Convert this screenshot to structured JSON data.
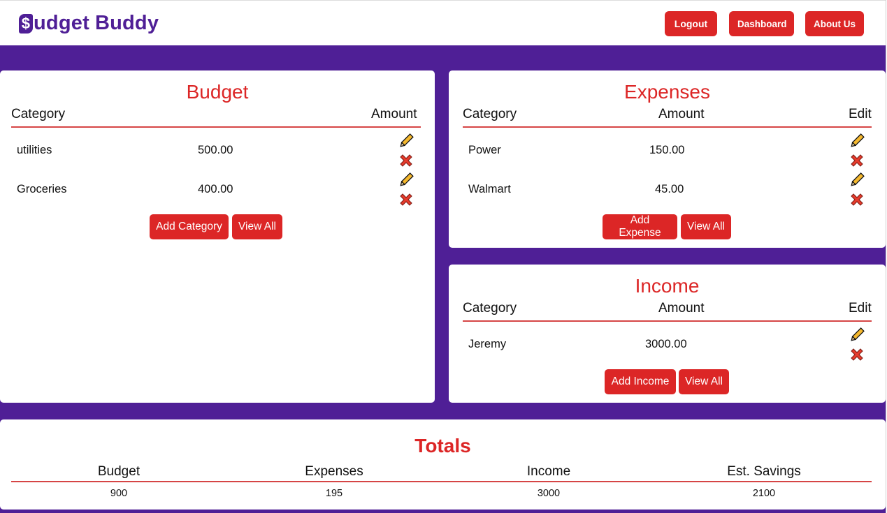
{
  "brand": {
    "part1": "udget",
    "part2": "Buddy"
  },
  "nav": {
    "logout": "Logout",
    "dashboard": "Dashboard",
    "about": "About Us"
  },
  "budget": {
    "title": "Budget",
    "col_category": "Category",
    "col_amount": "Amount",
    "rows": [
      {
        "category": "utilities",
        "amount": "500.00"
      },
      {
        "category": "Groceries",
        "amount": "400.00"
      }
    ],
    "add_button": "Add Category",
    "view_button": "View All"
  },
  "expenses": {
    "title": "Expenses",
    "col_category": "Category",
    "col_amount": "Amount",
    "col_edit": "Edit",
    "rows": [
      {
        "category": "Power",
        "amount": "150.00"
      },
      {
        "category": "Walmart",
        "amount": "45.00"
      }
    ],
    "add_button": "Add Expense",
    "view_button": "View All"
  },
  "income": {
    "title": "Income",
    "col_category": "Category",
    "col_amount": "Amount",
    "col_edit": "Edit",
    "rows": [
      {
        "category": "Jeremy",
        "amount": "3000.00"
      }
    ],
    "add_button": "Add Income",
    "view_button": "View All"
  },
  "totals": {
    "title": "Totals",
    "headers": [
      "Budget",
      "Expenses",
      "Income",
      "Est. Savings"
    ],
    "values": [
      "900",
      "195",
      "3000",
      "2100"
    ]
  },
  "icons": {
    "edit": "pencil-icon",
    "delete": "x-icon"
  },
  "colors": {
    "brand_purple": "#4f1f96",
    "accent_red": "#dc2626",
    "pencil_yellow": "#f5b82e"
  }
}
